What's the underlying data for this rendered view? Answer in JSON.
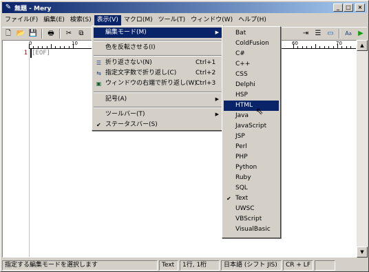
{
  "window": {
    "title": "無題 - Mery"
  },
  "menubar": {
    "items": [
      "ファイル(F)",
      "編集(E)",
      "検索(S)",
      "表示(V)",
      "マクロ(M)",
      "ツール(T)",
      "ウィンドウ(W)",
      "ヘルプ(H)"
    ],
    "active_index": 3
  },
  "ruler": {
    "labels": [
      "0",
      "10",
      "60",
      "70"
    ]
  },
  "editor": {
    "line_number": "1",
    "eof_marker": "[EOF]"
  },
  "view_menu": {
    "items": [
      {
        "label": "編集モード(M)",
        "submenu": true,
        "highlighted": true
      },
      {
        "label": "色を反転させる(I)"
      },
      {
        "label": "折り返さない(N)",
        "shortcut": "Ctrl+1",
        "icon": "no-wrap-icon"
      },
      {
        "label": "指定文字数で折り返し(C)",
        "shortcut": "Ctrl+2",
        "icon": "wrap-chars-icon"
      },
      {
        "label": "ウィンドウの右端で折り返し(W)",
        "shortcut": "Ctrl+3",
        "icon": "wrap-window-icon"
      },
      {
        "label": "記号(A)",
        "submenu": true
      },
      {
        "label": "ツールバー(T)",
        "submenu": true
      },
      {
        "label": "ステータスバー(S)",
        "checked": true
      }
    ]
  },
  "mode_menu": {
    "items": [
      "Bat",
      "ColdFusion",
      "C#",
      "C++",
      "CSS",
      "Delphi",
      "HSP",
      "HTML",
      "Java",
      "JavaScript",
      "JSP",
      "Perl",
      "PHP",
      "Python",
      "Ruby",
      "SQL",
      "Text",
      "UWSC",
      "VBScript",
      "VisualBasic"
    ],
    "highlighted": "HTML",
    "checked": "Text"
  },
  "statusbar": {
    "message": "指定する編集モードを選択します",
    "mode": "Text",
    "position": "1行, 1桁",
    "encoding": "日本語 (シフト JIS)",
    "line_ending": "CR + LF"
  },
  "colors": {
    "title_start": "#0a246a",
    "title_end": "#a6caf0",
    "highlight": "#0a246a",
    "line_number": "#c00000"
  }
}
